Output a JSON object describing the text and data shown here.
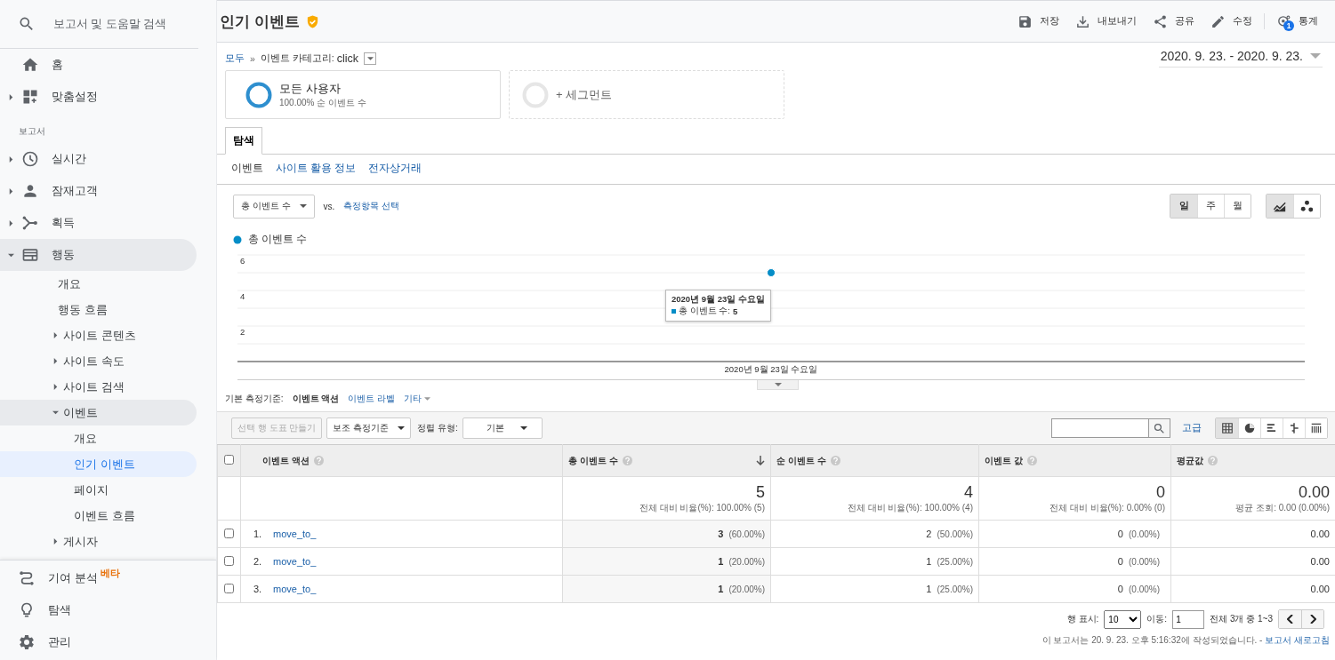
{
  "search": {
    "placeholder": "보고서 및 도움말 검색"
  },
  "sidebar": {
    "top": [
      {
        "label": "홈",
        "selected": false
      },
      {
        "label": "맞춤설정",
        "selected": false,
        "expanded": false
      }
    ],
    "section_label": "보고서",
    "reports": [
      {
        "label": "실시간",
        "selected": false,
        "expanded": false
      },
      {
        "label": "잠재고객",
        "selected": false,
        "expanded": false
      },
      {
        "label": "획득",
        "selected": false,
        "expanded": false
      },
      {
        "label": "행동",
        "selected": false,
        "expanded": true,
        "children": [
          {
            "label": "개요",
            "selected": false
          },
          {
            "label": "행동 흐름",
            "selected": false
          },
          {
            "label": "사이트 콘텐츠",
            "selected": false,
            "expanded": false
          },
          {
            "label": "사이트 속도",
            "selected": false,
            "expanded": false
          },
          {
            "label": "사이트 검색",
            "selected": false,
            "expanded": false
          },
          {
            "label": "이벤트",
            "selected": false,
            "expanded": true,
            "children": [
              {
                "label": "개요",
                "selected": false
              },
              {
                "label": "인기 이벤트",
                "selected": true
              },
              {
                "label": "페이지",
                "selected": false
              },
              {
                "label": "이벤트 흐름",
                "selected": false
              }
            ]
          },
          {
            "label": "게시자",
            "selected": false,
            "expanded": false
          }
        ]
      }
    ],
    "bottom": [
      {
        "label": "기여 분석",
        "badge": "베타",
        "selected": false
      },
      {
        "label": "탐색",
        "selected": false
      },
      {
        "label": "관리",
        "selected": false
      }
    ]
  },
  "header": {
    "title": "인기 이벤트",
    "verified": true,
    "actions": [
      {
        "label": "저장"
      },
      {
        "label": "내보내기"
      },
      {
        "label": "공유"
      },
      {
        "label": "수정"
      },
      {
        "label": "통계",
        "badge": "1"
      }
    ]
  },
  "breadcrumb": {
    "root": "모두",
    "separator": "»",
    "label": "이벤트 카테고리:",
    "value": "click"
  },
  "date_range": "2020. 9. 23. - 2020. 9. 23.",
  "segments": [
    {
      "kind": "active",
      "title": "모든 사용자",
      "subtitle": "100.00% 순 이벤트 수"
    },
    {
      "kind": "add",
      "title": "+ 세그먼트"
    }
  ],
  "tabs": [
    {
      "label": "탐색",
      "selected": true
    }
  ],
  "subtabs": [
    {
      "label": "이벤트",
      "selected": true
    },
    {
      "label": "사이트 활용 정보",
      "selected": false
    },
    {
      "label": "전자상거래",
      "selected": false
    }
  ],
  "chart_controls": {
    "metric": "총 이벤트 수",
    "vs": "vs.",
    "add_metric": "측정항목 선택",
    "periods": [
      {
        "label": "일",
        "selected": true
      },
      {
        "label": "주",
        "selected": false
      },
      {
        "label": "월",
        "selected": false
      }
    ],
    "chart_types": [
      {
        "kind": "line",
        "selected": true
      },
      {
        "kind": "motion",
        "selected": false
      }
    ]
  },
  "chart": {
    "chart_data": {
      "type": "line",
      "categories": [
        "2020년 9월 23일 수요일"
      ],
      "series": [
        {
          "name": "총 이벤트 수",
          "color": "#058dc7",
          "values": [
            5
          ],
          "marker": true
        }
      ],
      "ylim": [
        0,
        6
      ],
      "yticks": [
        2,
        4,
        6
      ]
    },
    "tooltip": {
      "title": "2020년 9월 23일 수요일",
      "label": "총 이벤트 수:",
      "value": "5"
    }
  },
  "dimensions": {
    "label": "기본 측정기준:",
    "items": [
      {
        "label": "이벤트 액션",
        "selected": true
      },
      {
        "label": "이벤트 라벨",
        "selected": false
      },
      {
        "label": "기타",
        "selected": false
      }
    ]
  },
  "toolbar": {
    "plot_rows": {
      "label": "선택 행 도표 만들기",
      "disabled": true
    },
    "secondary": "보조 측정기준",
    "sort_label": "정렬 유형:",
    "sort_value": "기본",
    "advanced": "고급",
    "views": [
      {
        "kind": "table",
        "selected": true
      },
      {
        "kind": "pie",
        "selected": false
      },
      {
        "kind": "bars",
        "selected": false
      },
      {
        "kind": "comparison",
        "selected": false
      },
      {
        "kind": "pivot",
        "selected": false
      }
    ]
  },
  "table": {
    "select_all": {
      "checked": false
    },
    "columns": [
      {
        "label": "이벤트 액션",
        "sorted": false
      },
      {
        "label": "총 이벤트 수",
        "sorted": true
      },
      {
        "label": "순 이벤트 수",
        "sorted": false
      },
      {
        "label": "이벤트 값",
        "sorted": false
      },
      {
        "label": "평균값",
        "sorted": false
      }
    ],
    "totals": [
      {
        "value": "5",
        "note": "전체 대비 비율(%): 100.00% (5)"
      },
      {
        "value": "4",
        "note": "전체 대비 비율(%): 100.00% (4)"
      },
      {
        "value": "0",
        "note": "전체 대비 비율(%): 0.00% (0)"
      },
      {
        "value": "0.00",
        "note": "평균 조회: 0.00 (0.00%)"
      }
    ],
    "rows": [
      {
        "checked": false,
        "cells": [
          {
            "index": "1.",
            "value": "move_to_"
          },
          {
            "value": "3",
            "pct": "(60.00%)"
          },
          {
            "value": "2",
            "pct": "(50.00%)"
          },
          {
            "value": "0",
            "pct": "(0.00%)"
          },
          {
            "value": "0.00"
          }
        ]
      },
      {
        "checked": false,
        "cells": [
          {
            "index": "2.",
            "value": "move_to_"
          },
          {
            "value": "1",
            "pct": "(20.00%)"
          },
          {
            "value": "1",
            "pct": "(25.00%)"
          },
          {
            "value": "0",
            "pct": "(0.00%)"
          },
          {
            "value": "0.00"
          }
        ]
      },
      {
        "checked": false,
        "cells": [
          {
            "index": "3.",
            "value": "move_to_"
          },
          {
            "value": "1",
            "pct": "(20.00%)"
          },
          {
            "value": "1",
            "pct": "(25.00%)"
          },
          {
            "value": "0",
            "pct": "(0.00%)"
          },
          {
            "value": "0.00"
          }
        ]
      }
    ]
  },
  "pagination": {
    "rows_label": "행 표시:",
    "rows_value": "10",
    "goto_label": "이동:",
    "goto_value": "1",
    "range": "전체 3개 중 1~3"
  },
  "footer": {
    "note": "이 보고서는 20. 9. 23. 오후 5:16:32에 작성되었습니다. -",
    "link": "보고서 새로고침"
  }
}
